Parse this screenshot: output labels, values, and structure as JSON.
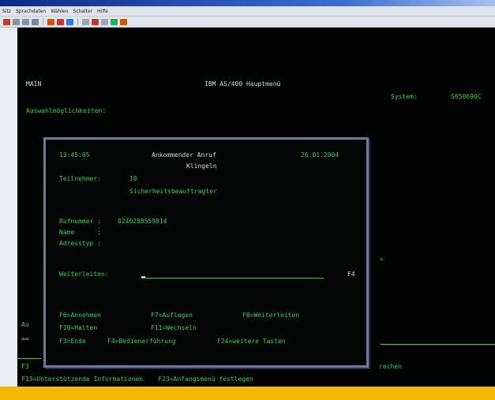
{
  "menu": [
    "Sitz",
    "Sprachdaten",
    "Wählen",
    "Schalter",
    "Hilfe"
  ],
  "toolbar_icons": [
    "red-icon",
    "grid-icon",
    "arrow-icon",
    "green-icon"
  ],
  "screen": {
    "program": "MAIN",
    "title": "IBM AS/400 Hauptmenü",
    "system_label": "System:",
    "system_value": "S650690C",
    "options_label": "Auswahlmöglichkeiten:",
    "left_fragment_1": "Au",
    "left_fragment_2": "==",
    "left_fragment_3": "F3",
    "right_fragment": "rechen",
    "footer_line": "F13=Unterstützende Informationen    F23=Anfangsmenü festlegen"
  },
  "popup": {
    "time": "13:45:05",
    "heading": "Ankommender Anruf",
    "date": "26.01.2004",
    "subheading": "Klingeln",
    "participant_label": "Teilnehmer:",
    "participant_number": "10",
    "participant_name": "Sicherheitsbeauftragter",
    "phone_label": "Rufnummer :",
    "phone_value": "0240288559814",
    "name_label": "Name      :",
    "address_label": "Adresstyp :",
    "forward_label": "Weiterleiten:",
    "forward_key": "F4",
    "fkeys_row1": [
      "F6=Annehmen",
      "F7=Auflegen",
      "F8=Weiterleiten"
    ],
    "fkeys_row2": [
      "F10=Halten",
      "F11=Wechseln"
    ],
    "fkeys_row3": [
      "F3=Ende",
      "F4=Bedienerführung",
      "F24=weitere Tasten"
    ]
  }
}
